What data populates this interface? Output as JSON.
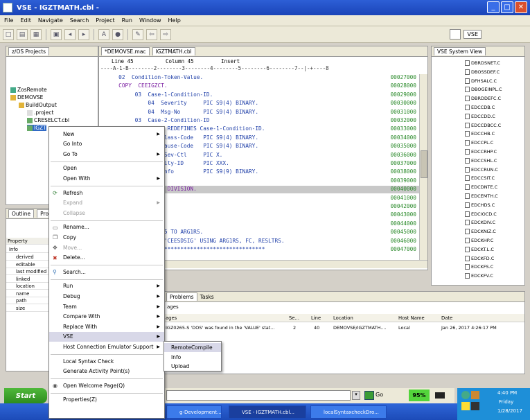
{
  "window": {
    "title": "VSE - IGZTMATH.cbl -"
  },
  "menu": [
    "File",
    "Edit",
    "Navigate",
    "Search",
    "Project",
    "Run",
    "Window",
    "Help"
  ],
  "perspective": {
    "label": "VSE"
  },
  "project_explorer": {
    "tab": "z/OS Projects",
    "tree": [
      "ZosRemote",
      "DEMOVSE",
      "BuildOutput",
      ".project",
      "CRESELCT.cbl",
      "IGZT"
    ]
  },
  "editor": {
    "tabs": [
      "*DEMOVSE.mac",
      "IGZTMATH.cbl"
    ],
    "status": {
      "line": "Line 45",
      "column": "Column 45",
      "mode": "Insert"
    },
    "ruler": "----A-1-B--------2--------3--------4--------5--------6--------7--|-+----8",
    "lines": [
      {
        "code": "      02  Condition-Token-Value.",
        "num": "00027000"
      },
      {
        "code": "      COPY  CEEIGZCT.",
        "num": "00028000"
      },
      {
        "code": "           03  Case-1-Condition-ID.",
        "num": "00029000"
      },
      {
        "code": "               04  Severity     PIC S9(4) BINARY.",
        "num": "00030000"
      },
      {
        "code": "               04  Msg-No       PIC S9(4) BINARY.",
        "num": "00031000"
      },
      {
        "code": "           03  Case-2-Condition-ID",
        "num": "00032000"
      },
      {
        "code": "                     REDEFINES Case-1-Condition-ID.",
        "num": "00033000"
      },
      {
        "code": "               04  Class-Code   PIC S9(4) BINARY.",
        "num": "00034000"
      },
      {
        "code": "               04  Cause-Code   PIC S9(4) BINARY.",
        "num": "00035000"
      },
      {
        "code": "           03  Case-Sev-Ctl     PIC X.",
        "num": "00036000"
      },
      {
        "code": "           03  Facility-ID      PIC XXX.",
        "num": "00037000"
      },
      {
        "code": "           03  I-S-Info         PIC S9(9) BINARY.",
        "num": "00038000"
      },
      {
        "code": "",
        "num": "00039000"
      },
      {
        "code": "           PROCEDURE DIVISION.",
        "num": "00040000"
      },
      {
        "code": "",
        "num": "00041000"
      },
      {
        "code": "",
        "num": "00042000"
      },
      {
        "code": "",
        "num": "00043000"
      },
      {
        "code": "",
        "num": "00044000"
      },
      {
        "code": "               MOVE 5 TO ARG1RS.",
        "num": "00045000"
      },
      {
        "code": "               CALL 'CEESDSIG' USING ARG1RS, FC, RESLTRS.",
        "num": "00046000"
      },
      {
        "code": "               ************************************",
        "num": "00047000"
      }
    ]
  },
  "system_view": {
    "tab": "VSE System View",
    "items": [
      "DBRDSNET.C",
      "DBOSSDEF.C",
      "DFHSALC.C",
      "DBOGEINPL.C",
      "DBRDDEFC.C",
      "EDCCDB.C",
      "EDCCDD.C",
      "EDCCDBCC.C",
      "EDCCHB.C",
      "EDCCPL.C",
      "EDCCRHP.C",
      "EDCCSHL.C",
      "EDCCRUN.C",
      "EDCCSIT.C",
      "EDCDNTE.C",
      "EDCEMTH.C",
      "EDCHDS.C",
      "EDCIOCD.C",
      "EDCKDIV.C",
      "EDCKNIZ.C",
      "EDCKHP.C",
      "EDCKT.L.C",
      "EDCKFD.C",
      "EDCKFS.C",
      "EDCKFV.C"
    ]
  },
  "outline_panel": {
    "tabs": [
      "Outline",
      "Properties"
    ],
    "header": "Property",
    "group": "Info",
    "properties": [
      "derived",
      "editable",
      "last modified",
      "linked",
      "location",
      "name",
      "path",
      "size"
    ]
  },
  "problems": {
    "tabs": [
      "Problems",
      "Tasks"
    ],
    "summary": "ages",
    "columns": [
      "ages",
      "Se...",
      "Line",
      "Location",
      "Host Name",
      "Date"
    ],
    "row": {
      "msg": "IGZ0265-S 'DOS' was found in the 'VALUE' stat...",
      "sev": "2",
      "line": "40",
      "location": "DEMOVSE/IGZTMATH....",
      "host": "Local",
      "date": "Jan 26, 2017 4:26:17 PM"
    }
  },
  "context_menu": [
    {
      "label": "New",
      "submenu": true
    },
    {
      "label": "Go Into"
    },
    {
      "label": "Go To",
      "submenu": true
    },
    {
      "sep": true
    },
    {
      "label": "Open"
    },
    {
      "label": "Open With",
      "submenu": true
    },
    {
      "sep": true
    },
    {
      "label": "Refresh",
      "icon": "refresh-icon"
    },
    {
      "label": "Expand",
      "disabled": true,
      "submenu": true
    },
    {
      "label": "Collapse",
      "disabled": true
    },
    {
      "sep": true
    },
    {
      "label": "Rename...",
      "icon": "rename-icon"
    },
    {
      "label": "Copy",
      "icon": "copy-icon"
    },
    {
      "label": "Move...",
      "icon": "move-icon",
      "disabled": true
    },
    {
      "label": "Delete...",
      "icon": "delete-icon"
    },
    {
      "sep": true
    },
    {
      "label": "Search...",
      "icon": "search-icon"
    },
    {
      "sep": true
    },
    {
      "label": "Run",
      "submenu": true
    },
    {
      "label": "Debug",
      "submenu": true
    },
    {
      "label": "Team",
      "submenu": true
    },
    {
      "label": "Compare With",
      "submenu": true
    },
    {
      "label": "Replace With",
      "submenu": true
    },
    {
      "label": "VSE",
      "submenu": true,
      "active": true
    },
    {
      "label": "Host Connection Emulator Support",
      "submenu": true
    },
    {
      "sep": true
    },
    {
      "label": "Local Syntax Check"
    },
    {
      "label": "Generate Activity Point(s)"
    },
    {
      "sep": true
    },
    {
      "label": "Open Welcome Page(Q)",
      "icon": "welcome-icon"
    },
    {
      "sep": true
    },
    {
      "label": "Properties(Z)"
    }
  ],
  "vse_submenu": [
    {
      "label": "RemoteCompile",
      "active": true
    },
    {
      "label": "Info"
    },
    {
      "label": "Upload"
    }
  ],
  "statusbar": {
    "zoom": "95%",
    "go": "Go"
  },
  "taskbar": {
    "start": "Start",
    "buttons": [
      {
        "label": "g-Development..."
      },
      {
        "label": "VSE - IGZTMATH.cbl...",
        "active": true
      },
      {
        "label": "localSyntaxcheckDro..."
      }
    ],
    "clock": {
      "time": "4:40 PM",
      "day": "Friday",
      "date": "1/28/2017"
    }
  }
}
